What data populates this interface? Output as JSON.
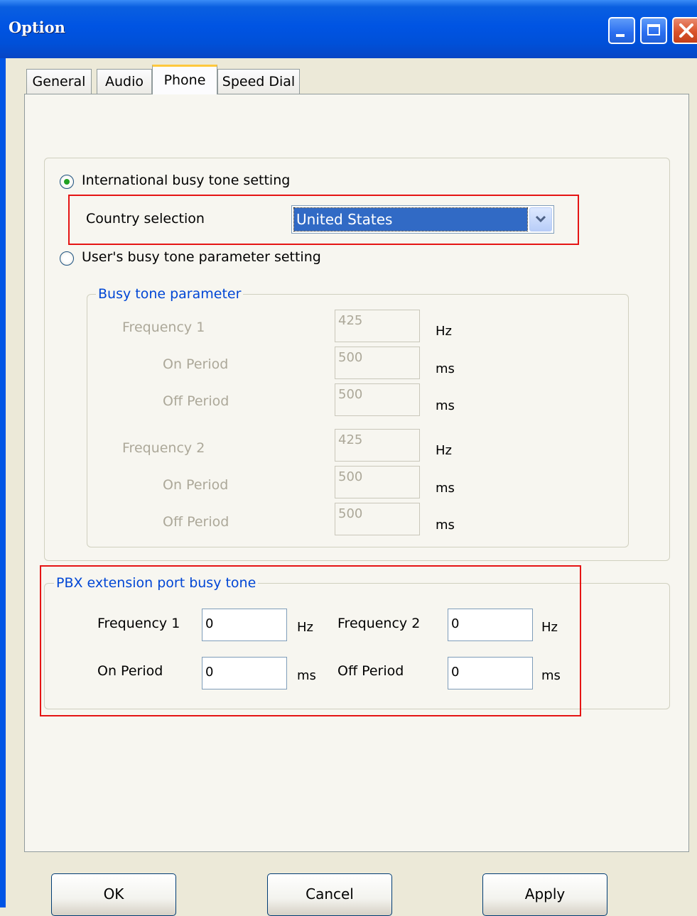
{
  "window": {
    "title": "Option"
  },
  "tabs": [
    {
      "label": "General",
      "active": false
    },
    {
      "label": "Audio",
      "active": false
    },
    {
      "label": "Phone",
      "active": true
    },
    {
      "label": "Speed Dial",
      "active": false
    }
  ],
  "busy_tone": {
    "intl_option_label": "International busy tone setting",
    "intl_selected": true,
    "country_label": "Country selection",
    "country_value": "United States",
    "user_option_label": "User's busy tone parameter setting",
    "user_selected": false,
    "param_group_title": "Busy tone parameter",
    "params": [
      {
        "label": "Frequency 1",
        "value": "425",
        "unit": "Hz"
      },
      {
        "label": "On Period",
        "value": "500",
        "unit": "ms"
      },
      {
        "label": "Off Period",
        "value": "500",
        "unit": "ms"
      },
      {
        "label": "Frequency 2",
        "value": "425",
        "unit": "Hz"
      },
      {
        "label": "On Period",
        "value": "500",
        "unit": "ms"
      },
      {
        "label": "Off Period",
        "value": "500",
        "unit": "ms"
      }
    ]
  },
  "pbx": {
    "group_title": "PBX extension port busy tone",
    "freq1": {
      "label": "Frequency 1",
      "value": "0",
      "unit": "Hz"
    },
    "freq2": {
      "label": "Frequency 2",
      "value": "0",
      "unit": "Hz"
    },
    "on_period": {
      "label": "On Period",
      "value": "0",
      "unit": "ms"
    },
    "off_period": {
      "label": "Off Period",
      "value": "0",
      "unit": "ms"
    }
  },
  "buttons": {
    "ok": "OK",
    "cancel": "Cancel",
    "apply": "Apply"
  },
  "colors": {
    "titlebar": "#0054e3",
    "highlight": "#e51414",
    "group_title": "#0046d5",
    "selection": "#316ac5"
  }
}
